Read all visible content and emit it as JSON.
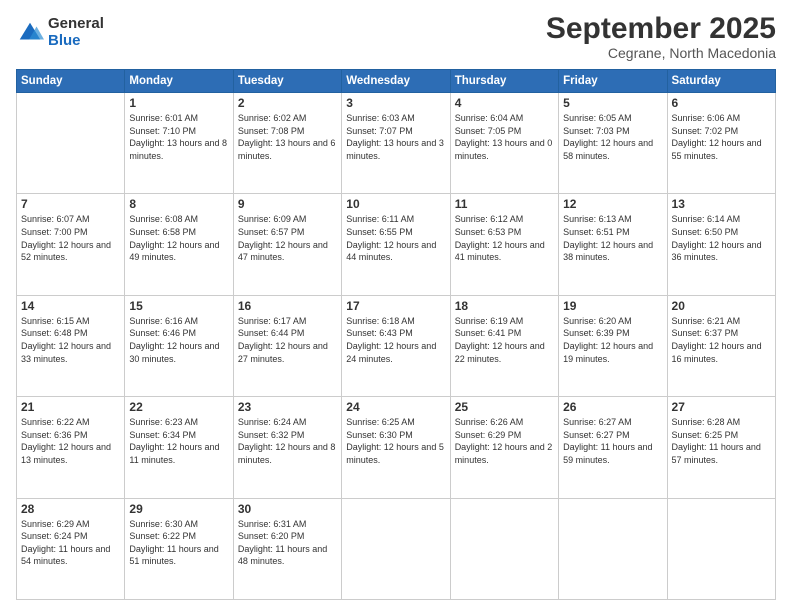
{
  "logo": {
    "general": "General",
    "blue": "Blue"
  },
  "header": {
    "month": "September 2025",
    "location": "Cegrane, North Macedonia"
  },
  "days": [
    "Sunday",
    "Monday",
    "Tuesday",
    "Wednesday",
    "Thursday",
    "Friday",
    "Saturday"
  ],
  "weeks": [
    [
      {
        "day": "",
        "sunrise": "",
        "sunset": "",
        "daylight": ""
      },
      {
        "day": "1",
        "sunrise": "Sunrise: 6:01 AM",
        "sunset": "Sunset: 7:10 PM",
        "daylight": "Daylight: 13 hours and 8 minutes."
      },
      {
        "day": "2",
        "sunrise": "Sunrise: 6:02 AM",
        "sunset": "Sunset: 7:08 PM",
        "daylight": "Daylight: 13 hours and 6 minutes."
      },
      {
        "day": "3",
        "sunrise": "Sunrise: 6:03 AM",
        "sunset": "Sunset: 7:07 PM",
        "daylight": "Daylight: 13 hours and 3 minutes."
      },
      {
        "day": "4",
        "sunrise": "Sunrise: 6:04 AM",
        "sunset": "Sunset: 7:05 PM",
        "daylight": "Daylight: 13 hours and 0 minutes."
      },
      {
        "day": "5",
        "sunrise": "Sunrise: 6:05 AM",
        "sunset": "Sunset: 7:03 PM",
        "daylight": "Daylight: 12 hours and 58 minutes."
      },
      {
        "day": "6",
        "sunrise": "Sunrise: 6:06 AM",
        "sunset": "Sunset: 7:02 PM",
        "daylight": "Daylight: 12 hours and 55 minutes."
      }
    ],
    [
      {
        "day": "7",
        "sunrise": "Sunrise: 6:07 AM",
        "sunset": "Sunset: 7:00 PM",
        "daylight": "Daylight: 12 hours and 52 minutes."
      },
      {
        "day": "8",
        "sunrise": "Sunrise: 6:08 AM",
        "sunset": "Sunset: 6:58 PM",
        "daylight": "Daylight: 12 hours and 49 minutes."
      },
      {
        "day": "9",
        "sunrise": "Sunrise: 6:09 AM",
        "sunset": "Sunset: 6:57 PM",
        "daylight": "Daylight: 12 hours and 47 minutes."
      },
      {
        "day": "10",
        "sunrise": "Sunrise: 6:11 AM",
        "sunset": "Sunset: 6:55 PM",
        "daylight": "Daylight: 12 hours and 44 minutes."
      },
      {
        "day": "11",
        "sunrise": "Sunrise: 6:12 AM",
        "sunset": "Sunset: 6:53 PM",
        "daylight": "Daylight: 12 hours and 41 minutes."
      },
      {
        "day": "12",
        "sunrise": "Sunrise: 6:13 AM",
        "sunset": "Sunset: 6:51 PM",
        "daylight": "Daylight: 12 hours and 38 minutes."
      },
      {
        "day": "13",
        "sunrise": "Sunrise: 6:14 AM",
        "sunset": "Sunset: 6:50 PM",
        "daylight": "Daylight: 12 hours and 36 minutes."
      }
    ],
    [
      {
        "day": "14",
        "sunrise": "Sunrise: 6:15 AM",
        "sunset": "Sunset: 6:48 PM",
        "daylight": "Daylight: 12 hours and 33 minutes."
      },
      {
        "day": "15",
        "sunrise": "Sunrise: 6:16 AM",
        "sunset": "Sunset: 6:46 PM",
        "daylight": "Daylight: 12 hours and 30 minutes."
      },
      {
        "day": "16",
        "sunrise": "Sunrise: 6:17 AM",
        "sunset": "Sunset: 6:44 PM",
        "daylight": "Daylight: 12 hours and 27 minutes."
      },
      {
        "day": "17",
        "sunrise": "Sunrise: 6:18 AM",
        "sunset": "Sunset: 6:43 PM",
        "daylight": "Daylight: 12 hours and 24 minutes."
      },
      {
        "day": "18",
        "sunrise": "Sunrise: 6:19 AM",
        "sunset": "Sunset: 6:41 PM",
        "daylight": "Daylight: 12 hours and 22 minutes."
      },
      {
        "day": "19",
        "sunrise": "Sunrise: 6:20 AM",
        "sunset": "Sunset: 6:39 PM",
        "daylight": "Daylight: 12 hours and 19 minutes."
      },
      {
        "day": "20",
        "sunrise": "Sunrise: 6:21 AM",
        "sunset": "Sunset: 6:37 PM",
        "daylight": "Daylight: 12 hours and 16 minutes."
      }
    ],
    [
      {
        "day": "21",
        "sunrise": "Sunrise: 6:22 AM",
        "sunset": "Sunset: 6:36 PM",
        "daylight": "Daylight: 12 hours and 13 minutes."
      },
      {
        "day": "22",
        "sunrise": "Sunrise: 6:23 AM",
        "sunset": "Sunset: 6:34 PM",
        "daylight": "Daylight: 12 hours and 11 minutes."
      },
      {
        "day": "23",
        "sunrise": "Sunrise: 6:24 AM",
        "sunset": "Sunset: 6:32 PM",
        "daylight": "Daylight: 12 hours and 8 minutes."
      },
      {
        "day": "24",
        "sunrise": "Sunrise: 6:25 AM",
        "sunset": "Sunset: 6:30 PM",
        "daylight": "Daylight: 12 hours and 5 minutes."
      },
      {
        "day": "25",
        "sunrise": "Sunrise: 6:26 AM",
        "sunset": "Sunset: 6:29 PM",
        "daylight": "Daylight: 12 hours and 2 minutes."
      },
      {
        "day": "26",
        "sunrise": "Sunrise: 6:27 AM",
        "sunset": "Sunset: 6:27 PM",
        "daylight": "Daylight: 11 hours and 59 minutes."
      },
      {
        "day": "27",
        "sunrise": "Sunrise: 6:28 AM",
        "sunset": "Sunset: 6:25 PM",
        "daylight": "Daylight: 11 hours and 57 minutes."
      }
    ],
    [
      {
        "day": "28",
        "sunrise": "Sunrise: 6:29 AM",
        "sunset": "Sunset: 6:24 PM",
        "daylight": "Daylight: 11 hours and 54 minutes."
      },
      {
        "day": "29",
        "sunrise": "Sunrise: 6:30 AM",
        "sunset": "Sunset: 6:22 PM",
        "daylight": "Daylight: 11 hours and 51 minutes."
      },
      {
        "day": "30",
        "sunrise": "Sunrise: 6:31 AM",
        "sunset": "Sunset: 6:20 PM",
        "daylight": "Daylight: 11 hours and 48 minutes."
      },
      {
        "day": "",
        "sunrise": "",
        "sunset": "",
        "daylight": ""
      },
      {
        "day": "",
        "sunrise": "",
        "sunset": "",
        "daylight": ""
      },
      {
        "day": "",
        "sunrise": "",
        "sunset": "",
        "daylight": ""
      },
      {
        "day": "",
        "sunrise": "",
        "sunset": "",
        "daylight": ""
      }
    ]
  ]
}
